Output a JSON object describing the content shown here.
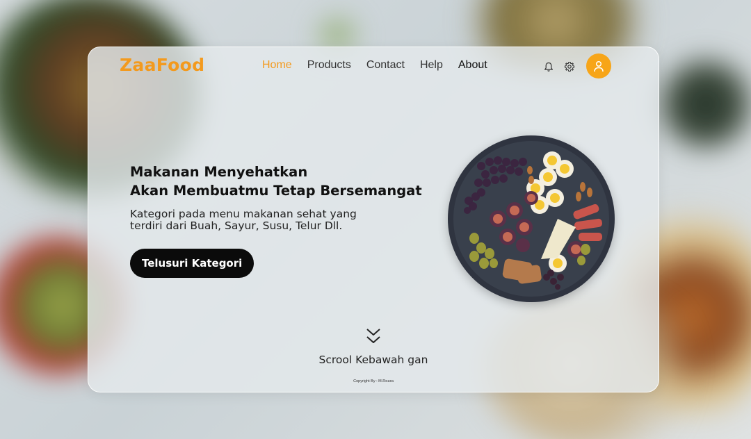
{
  "brand": {
    "logo_text": "ZaaFood",
    "accent_color": "#f39a1e"
  },
  "nav": {
    "items": [
      {
        "label": "Home",
        "active": true
      },
      {
        "label": "Products",
        "active": false
      },
      {
        "label": "Contact",
        "active": false
      },
      {
        "label": "Help",
        "active": false
      },
      {
        "label": "About",
        "active": false
      }
    ]
  },
  "header_icons": [
    "bell-icon",
    "gear-icon",
    "user-icon"
  ],
  "hero": {
    "title_line1": "Makanan Menyehatkan",
    "title_line2": "Akan Membuatmu Tetap Bersemangat",
    "subtitle": "Kategori pada menu makanan sehat yang terdiri dari Buah, Sayur, Susu, Telur Dll.",
    "cta_label": "Telusuri Kategori"
  },
  "scroll": {
    "label": "Scrool Kebawah gan",
    "icon": "double-chevron-down-icon"
  },
  "footer": {
    "copyright": "Copyright By : M.Rezza"
  }
}
